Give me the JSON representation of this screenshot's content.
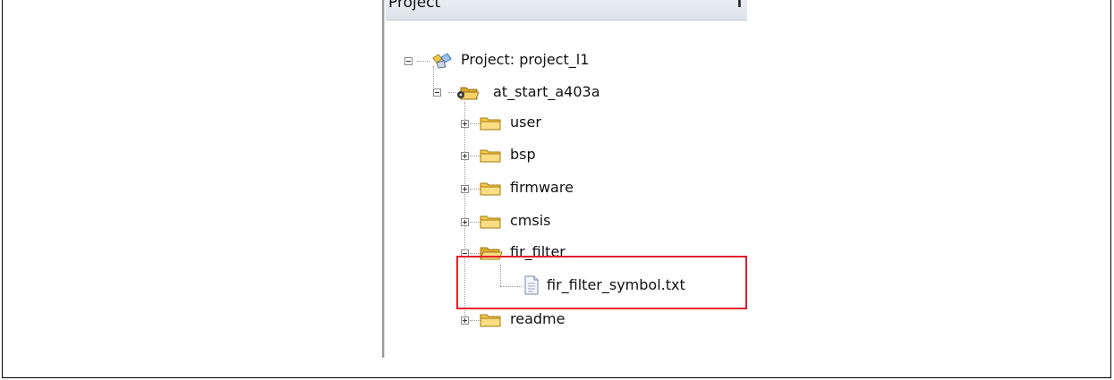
{
  "panel": {
    "title": "Project",
    "pin_glyph": "↕"
  },
  "tree": {
    "root": {
      "label": "Project: project_l1",
      "icon": "project-icon",
      "expanded": true
    },
    "target": {
      "label": "at_start_a403a",
      "icon": "target-folder-icon",
      "expanded": true
    },
    "groups": [
      {
        "label": "user",
        "expanded": false
      },
      {
        "label": "bsp",
        "expanded": false
      },
      {
        "label": "firmware",
        "expanded": false
      },
      {
        "label": "cmsis",
        "expanded": false
      },
      {
        "label": "fir_filter",
        "expanded": true
      },
      {
        "label": "readme",
        "expanded": false
      }
    ],
    "file": {
      "label": "fir_filter_symbol.txt",
      "icon": "text-file-icon"
    }
  },
  "colors": {
    "highlight": "#e2202a",
    "folder": "#f2c94c"
  }
}
